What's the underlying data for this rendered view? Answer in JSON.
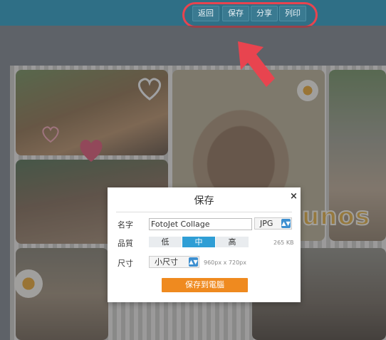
{
  "toolbar": {
    "buttons": [
      "返回",
      "保存",
      "分享",
      "列印"
    ]
  },
  "collage": {
    "sticker_text": "unos"
  },
  "dialog": {
    "title": "保存",
    "close_label": "×",
    "name_label": "名字",
    "name_value": "FotoJet Collage",
    "format_value": "JPG",
    "quality_label": "品質",
    "quality_options": [
      "低",
      "中",
      "高"
    ],
    "quality_selected": "中",
    "file_size": "265 KB",
    "size_label": "尺寸",
    "size_value": "小尺寸",
    "size_dimensions": "960px x 720px",
    "save_button": "保存到電腦"
  },
  "colors": {
    "toolbar_bg": "#2f6f86",
    "highlight": "#e8444f",
    "accent_blue": "#2f9ed5",
    "save_orange": "#ef8a1f"
  }
}
